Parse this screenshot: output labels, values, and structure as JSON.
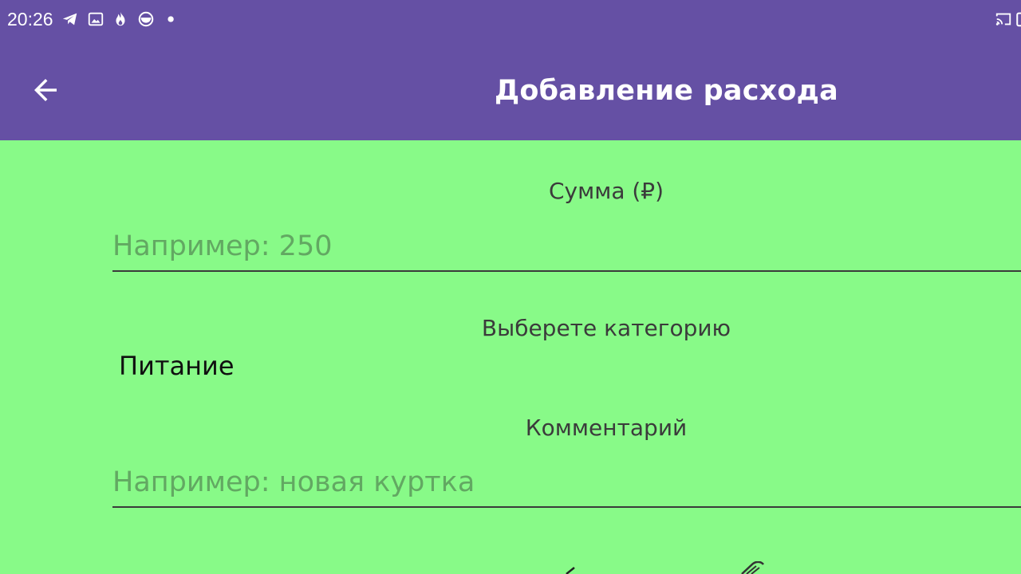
{
  "status_bar": {
    "time": "20:26",
    "icons": [
      "telegram-icon",
      "gallery-icon",
      "flame-icon",
      "app-circle-icon",
      "dot-icon",
      "cast-icon",
      "battery-icon"
    ]
  },
  "toolbar": {
    "back_icon": "arrow-back-icon",
    "title": "Добавление расхода"
  },
  "form": {
    "amount_label": "Сумма (₽)",
    "amount_placeholder": "Например: 250",
    "amount_value": "",
    "category_label": "Выберете категорию",
    "category_selected": "Питание",
    "comment_label": "Комментарий",
    "comment_placeholder": "Например: новая куртка",
    "comment_value": ""
  },
  "colors": {
    "toolbar": "#6550A4",
    "background": "#88FA88",
    "hint_text": "#62A862",
    "label_text": "#3b3b3b"
  }
}
